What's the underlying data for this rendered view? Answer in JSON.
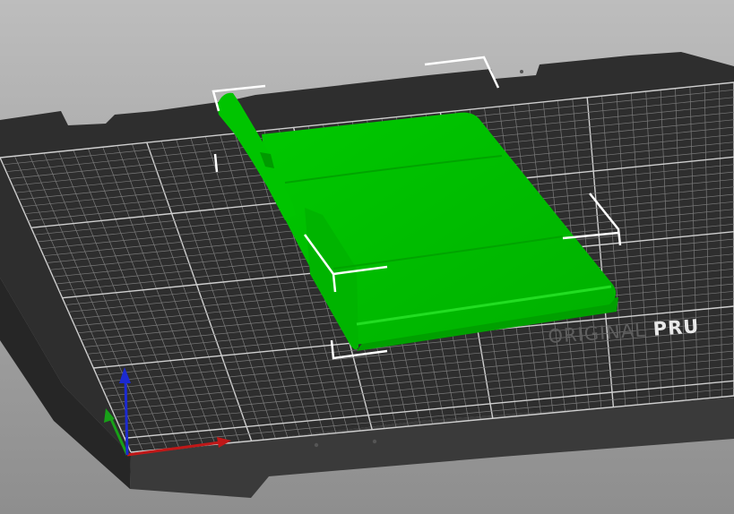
{
  "viewport": {
    "background_top": "#bdbdbd",
    "background_bottom": "#8e8e8e"
  },
  "bed": {
    "label_regular": "ORIGINAL",
    "label_bold": "PRU",
    "surface_color": "#2e2e2e",
    "grid_color": "#7a7a7a",
    "major_grid_color": "#cfcfcf"
  },
  "model": {
    "color": "#00c000",
    "selection_marker_color": "#ffffff"
  },
  "axes": {
    "x_color": "#c01818",
    "y_color": "#18a018",
    "z_color": "#1c2ad0"
  }
}
